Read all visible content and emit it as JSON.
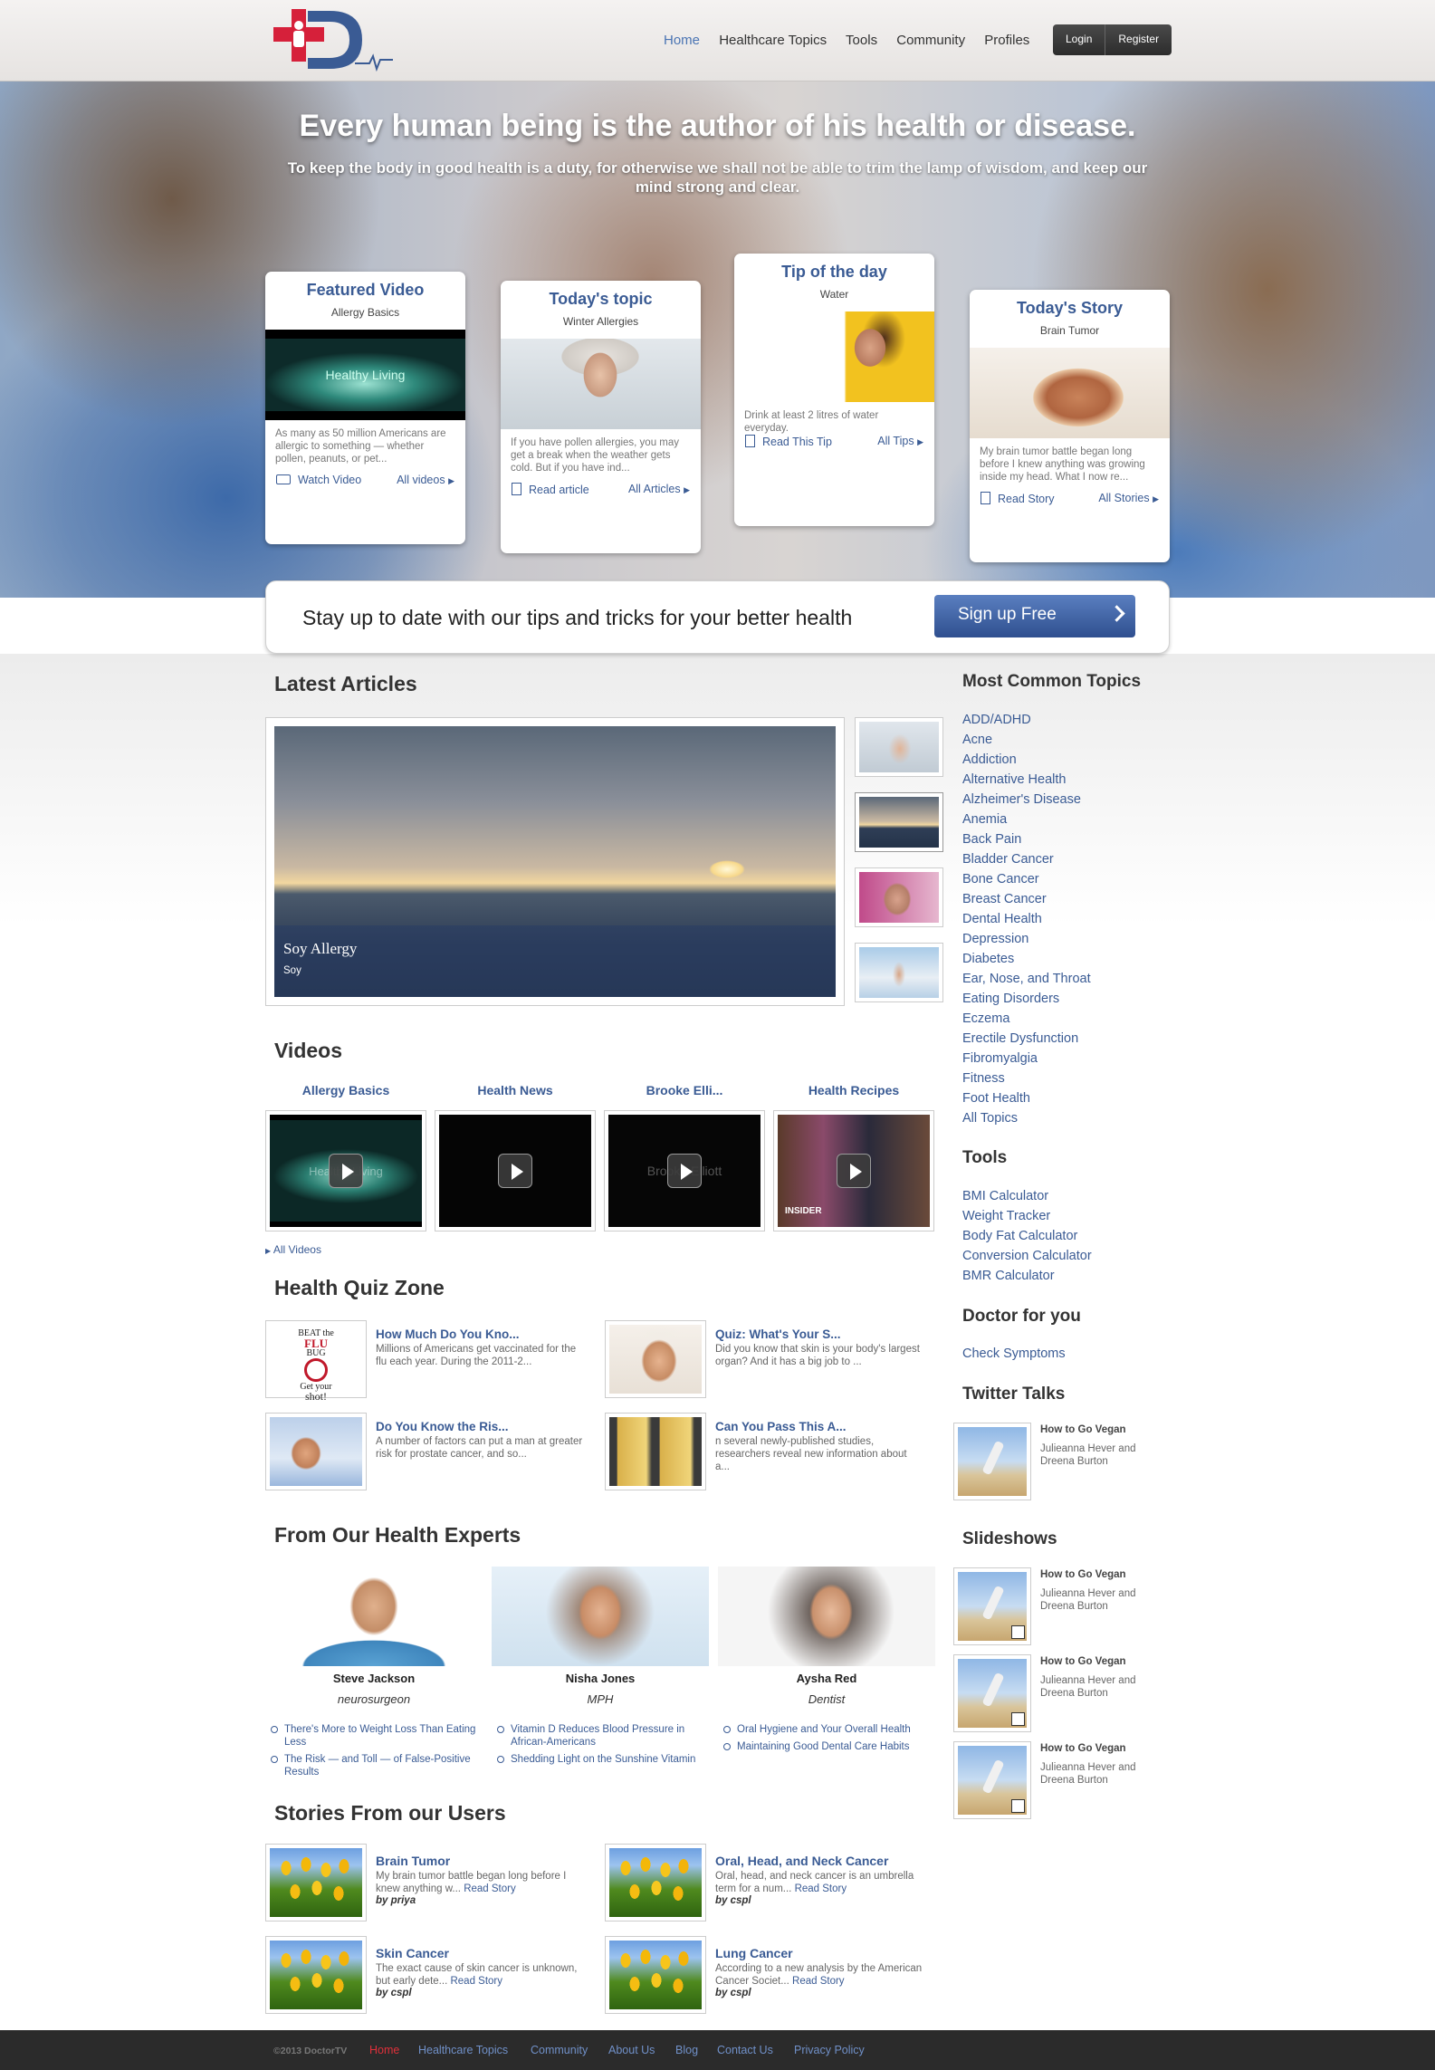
{
  "header": {
    "nav": [
      "Home",
      "Healthcare Topics",
      "Tools",
      "Community",
      "Profiles"
    ],
    "login": "Login",
    "register": "Register"
  },
  "hero": {
    "title": "Every human being is the author of his health or disease.",
    "subtitle": "To keep the body in good health is a duty, for otherwise we shall not be able to trim the lamp of wisdom, and keep our mind strong and clear."
  },
  "cards": [
    {
      "title": "Featured Video",
      "sub": "Allergy Basics",
      "img_text": "Healthy Living",
      "desc": "As many as 50 million Americans are allergic to something — whether pollen, peanuts, or pet...",
      "link": "Watch Video",
      "all": "All videos"
    },
    {
      "title": "Today's topic",
      "sub": "Winter Allergies",
      "desc": "If you have pollen allergies, you may get a break when the weather gets cold. But if you have ind...",
      "link": "Read article",
      "all": "All Articles"
    },
    {
      "title": "Tip of the day",
      "sub": "Water",
      "desc": "Drink at least 2 litres of water everyday.",
      "link": "Read This Tip",
      "all": "All Tips"
    },
    {
      "title": "Today's Story",
      "sub": "Brain Tumor",
      "desc": "My brain tumor battle began long before I knew anything was growing inside my head. What I now re...",
      "link": "Read Story",
      "all": "All Stories"
    }
  ],
  "signup": {
    "text": "Stay up to date with our tips and tricks for your better health",
    "button": "Sign up Free"
  },
  "latest": {
    "heading": "Latest Articles",
    "slide_title": "Soy Allergy",
    "slide_sub": "Soy"
  },
  "videos": {
    "heading": "Videos",
    "items": [
      "Allergy Basics",
      "Health News",
      "Brooke Elli...",
      "Health Recipes"
    ],
    "all": "All Videos",
    "overlay_text": [
      "Healthy Living",
      "",
      "Brooke Elliott",
      "INSIDER"
    ]
  },
  "quiz": {
    "heading": "Health Quiz Zone",
    "items": [
      {
        "title": "How Much Do You Kno...",
        "desc": "Millions of Americans get vaccinated for the flu each year. During the 2011-2..."
      },
      {
        "title": "Quiz: What's Your S...",
        "desc": "Did you know that skin is your body's largest organ? And it has a big job to ..."
      },
      {
        "title": "Do You Know the Ris...",
        "desc": "A number of factors can put a man at greater risk for prostate cancer, and so..."
      },
      {
        "title": "Can You Pass This A...",
        "desc": "n several newly-published studies, researchers reveal new information about a..."
      }
    ],
    "flu_img": [
      "BEAT the",
      "FLU",
      "BUG",
      "Get your",
      "shot!"
    ]
  },
  "experts": {
    "heading": "From Our Health Experts",
    "items": [
      {
        "name": "Steve Jackson",
        "role": "neurosurgeon",
        "links": [
          "There's More to Weight Loss Than Eating Less",
          "The Risk — and Toll — of False-Positive Results"
        ]
      },
      {
        "name": "Nisha Jones",
        "role": "MPH",
        "links": [
          "Vitamin D Reduces Blood Pressure in African-Americans",
          "Shedding Light on the Sunshine Vitamin"
        ]
      },
      {
        "name": "Aysha Red",
        "role": "Dentist",
        "links": [
          "Oral Hygiene and Your Overall Health",
          "Maintaining Good Dental Care Habits"
        ]
      }
    ]
  },
  "stories": {
    "heading": "Stories From our Users",
    "read": "Read Story",
    "items": [
      {
        "title": "Brain Tumor",
        "desc": "My brain tumor battle began long before I knew anything w...",
        "by": "by priya"
      },
      {
        "title": "Oral, Head, and Neck Cancer",
        "desc": "Oral, head, and neck cancer is an umbrella term for a num...",
        "by": "by cspl"
      },
      {
        "title": "Skin Cancer",
        "desc": "The exact cause of skin cancer is unknown, but early dete...",
        "by": "by cspl"
      },
      {
        "title": "Lung Cancer",
        "desc": "According to a new analysis by the American Cancer Societ...",
        "by": "by cspl"
      }
    ]
  },
  "sidebar": {
    "topics_heading": "Most Common Topics",
    "topics": [
      "ADD/ADHD",
      "Acne",
      "Addiction",
      "Alternative Health",
      "Alzheimer's Disease",
      "Anemia",
      "Back Pain",
      "Bladder Cancer",
      "Bone Cancer",
      "Breast Cancer",
      "Dental Health",
      "Depression",
      "Diabetes",
      "Ear, Nose, and Throat",
      "Eating Disorders",
      "Eczema",
      "Erectile Dysfunction",
      "Fibromyalgia",
      "Fitness",
      "Foot Health",
      "All Topics"
    ],
    "tools_heading": "Tools",
    "tools": [
      "BMI Calculator",
      "Weight Tracker",
      "Body Fat Calculator",
      "Conversion Calculator",
      "BMR Calculator"
    ],
    "doctor_heading": "Doctor for you",
    "doctor_link": "Check Symptoms",
    "twitter_heading": "Twitter Talks",
    "twitter": {
      "title": "How to Go Vegan",
      "by": "Julieanna Hever and Dreena Burton"
    },
    "slideshows_heading": "Slideshows",
    "slideshows": [
      {
        "title": "How to Go Vegan",
        "by": "Julieanna Hever and Dreena Burton"
      },
      {
        "title": "How to Go Vegan",
        "by": "Julieanna Hever and Dreena Burton"
      },
      {
        "title": "How to Go Vegan",
        "by": "Julieanna Hever and Dreena Burton"
      }
    ]
  },
  "footer": {
    "copyright": "©2013 DoctorTV",
    "links": [
      "Home",
      "Healthcare Topics",
      "Community",
      "About Us",
      "Blog",
      "Contact Us",
      "Privacy Policy"
    ]
  },
  "colors": {
    "link": "#3a5b94",
    "accent": "#4a74b3",
    "footer_bg": "#2b2b2b",
    "footer_active": "#e0303a",
    "logo_red": "#d6203a",
    "logo_blue": "#3a5b94"
  }
}
